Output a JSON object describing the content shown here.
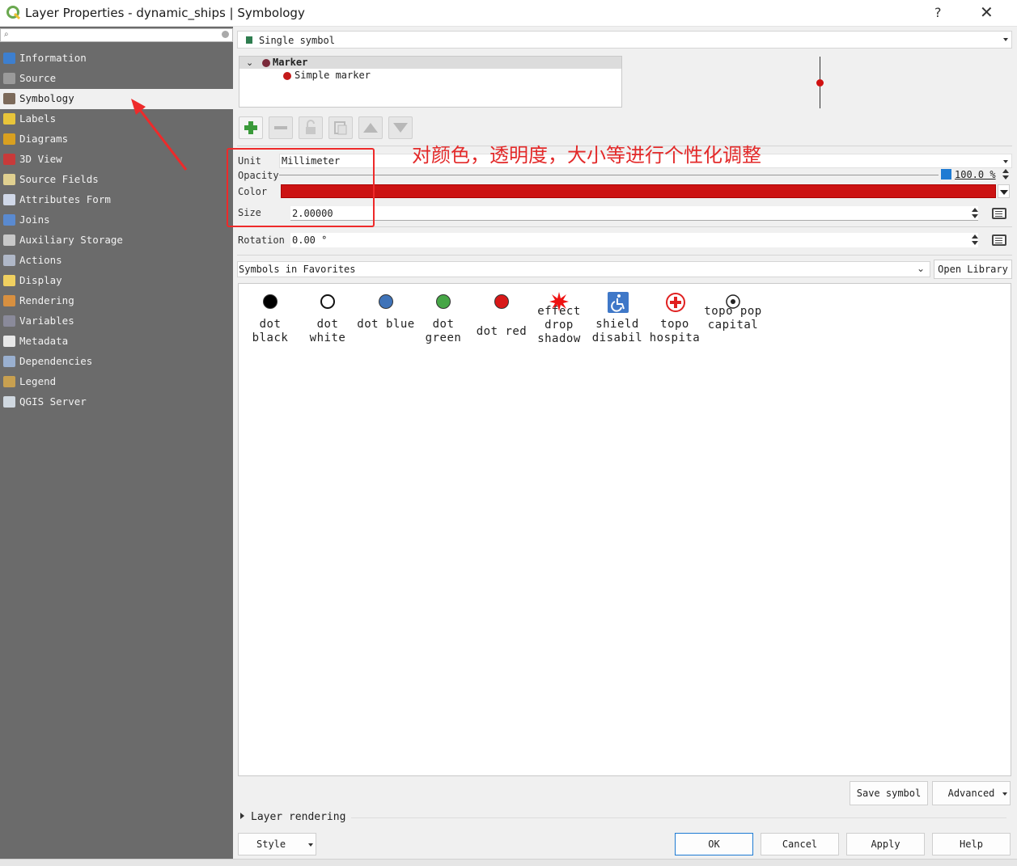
{
  "window": {
    "title": "Layer Properties - dynamic_ships | Symbology",
    "help": "?",
    "close": "✕"
  },
  "sidebar": {
    "items": [
      {
        "label": "Information",
        "icon": "information-icon",
        "color": "#3d7fcf"
      },
      {
        "label": "Source",
        "icon": "source-icon",
        "color": "#9a9a9a"
      },
      {
        "label": "Symbology",
        "icon": "symbology-icon",
        "color": "#7c6a5a"
      },
      {
        "label": "Labels",
        "icon": "labels-icon",
        "color": "#e8c53a"
      },
      {
        "label": "Diagrams",
        "icon": "diagrams-icon",
        "color": "#d8a020"
      },
      {
        "label": "3D View",
        "icon": "3d-view-icon",
        "color": "#c83a3a"
      },
      {
        "label": "Source Fields",
        "icon": "source-fields-icon",
        "color": "#e0d090"
      },
      {
        "label": "Attributes Form",
        "icon": "attributes-form-icon",
        "color": "#d0d8e8"
      },
      {
        "label": "Joins",
        "icon": "joins-icon",
        "color": "#5a8ad0"
      },
      {
        "label": "Auxiliary Storage",
        "icon": "auxiliary-storage-icon",
        "color": "#c8c8c8"
      },
      {
        "label": "Actions",
        "icon": "actions-icon",
        "color": "#b0b8c8"
      },
      {
        "label": "Display",
        "icon": "display-icon",
        "color": "#f0d060"
      },
      {
        "label": "Rendering",
        "icon": "rendering-icon",
        "color": "#d89040"
      },
      {
        "label": "Variables",
        "icon": "variables-icon",
        "color": "#8a8a9a"
      },
      {
        "label": "Metadata",
        "icon": "metadata-icon",
        "color": "#e8e8e8"
      },
      {
        "label": "Dependencies",
        "icon": "dependencies-icon",
        "color": "#9ab0d0"
      },
      {
        "label": "Legend",
        "icon": "legend-icon",
        "color": "#c8a050"
      },
      {
        "label": "QGIS Server",
        "icon": "qgis-server-icon",
        "color": "#d0d8e0"
      }
    ],
    "active_index": 2
  },
  "symbology": {
    "renderer": "Single symbol",
    "tree": {
      "marker": "Marker",
      "layer": "Simple marker"
    },
    "unit_label": "Unit",
    "unit_value": "Millimeter",
    "opacity_label": "Opacity",
    "opacity_value": "100.0 %",
    "color_label": "Color",
    "color_value": "#cc1313",
    "size_label": "Size",
    "size_value": "2.00000",
    "rotation_label": "Rotation",
    "rotation_value": "0.00 °",
    "favorites_label": "Symbols in Favorites",
    "open_library": "Open Library",
    "symbols": [
      {
        "name": "dot black",
        "kind": "dot",
        "color": "#000000"
      },
      {
        "name": "dot white",
        "kind": "dot-outline",
        "color": "#ffffff"
      },
      {
        "name": "dot blue",
        "kind": "dot",
        "color": "#3f73b8"
      },
      {
        "name": "dot green",
        "kind": "dot",
        "color": "#46a646"
      },
      {
        "name": "dot red",
        "kind": "dot",
        "color": "#d81818"
      },
      {
        "name": "effect drop shadow",
        "kind": "starburst",
        "color": "#ee1111"
      },
      {
        "name": "shield disabil",
        "kind": "wheelchair",
        "color": "#3f78c8"
      },
      {
        "name": "topo hospita",
        "kind": "hospital",
        "color": "#e02020"
      },
      {
        "name": "topo pop capital",
        "kind": "capital",
        "color": "#222222"
      }
    ],
    "save_symbol": "Save symbol",
    "advanced": "Advanced"
  },
  "annotation": {
    "text": "对颜色，透明度，大小等进行个性化调整",
    "color": "#e32a2a"
  },
  "footer": {
    "layer_rendering": "Layer rendering",
    "style": "Style",
    "ok": "OK",
    "cancel": "Cancel",
    "apply": "Apply",
    "help": "Help"
  }
}
